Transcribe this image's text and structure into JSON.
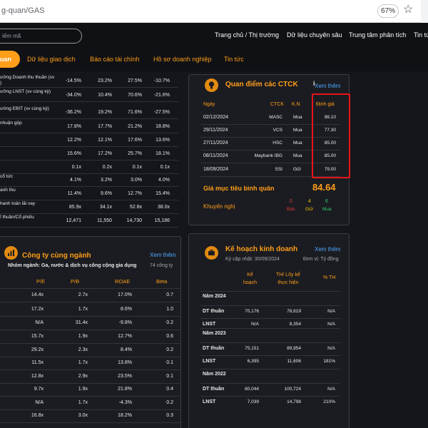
{
  "browser": {
    "url": "g-quan/GAS",
    "zoom": "67%"
  },
  "search": {
    "placeholder": "iếm mã"
  },
  "nav": [
    "Trang chủ / Thị trường",
    "Dữ liệu chuyên sâu",
    "Trung tâm phân tích",
    "Tin tứ"
  ],
  "tabs": {
    "active": "uan",
    "items": [
      "Dữ liệu giao dịch",
      "Báo cáo tài chính",
      "Hồ sơ doanh nghiệp",
      "Tin tức"
    ]
  },
  "financials": [
    {
      "label": "ưởng Doanh thu thuần (sv\n)",
      "values": [
        "-14.5%",
        "23.2%",
        "27.5%",
        "-10.7%"
      ]
    },
    {
      "label": "ưởng LNST (sv cùng kỳ)",
      "values": [
        "-34.0%",
        "10.4%",
        "70.6%",
        "-21.6%"
      ]
    },
    {
      "label": "ưởng EBIT (sv cùng kỳ)",
      "values": [
        "-36.2%",
        "19.2%",
        "71.6%",
        "-27.5%"
      ]
    },
    {
      "label": "nhuận gộp",
      "values": [
        "17.8%",
        "17.7%",
        "21.2%",
        "18.8%"
      ]
    },
    {
      "label": "",
      "values": [
        "12.2%",
        "12.1%",
        "17.6%",
        "13.6%"
      ]
    },
    {
      "label": "",
      "values": [
        "15.6%",
        "17.2%",
        "25.7%",
        "18.1%"
      ]
    },
    {
      "label": "",
      "values": [
        "0.1x",
        "0.2x",
        "0.1x",
        "0.1x"
      ]
    },
    {
      "label": "cổ tức",
      "values": [
        "4.1%",
        "3.2%",
        "3.0%",
        "4.0%"
      ]
    },
    {
      "label": "anh thu",
      "values": [
        "11.4%",
        "9.6%",
        "12.7%",
        "15.4%"
      ]
    },
    {
      "label": "hanh toán lãi vay",
      "values": [
        "85.9x",
        "34.1x",
        "52.8x",
        "38.0x"
      ]
    },
    {
      "label": "ĩ thuần/Cổ phiếu",
      "values": [
        "12,471",
        "11,550",
        "14,730",
        "15,186"
      ]
    }
  ],
  "broker": {
    "title": "Quan điểm các CTCK",
    "info": "i",
    "see_more": "Xem thêm",
    "headers": {
      "date": "Ngày",
      "ctck": "CTCK",
      "kn": "K.N",
      "price": "Định giá"
    },
    "rows": [
      {
        "date": "02/12/2024",
        "ctck": "MASC",
        "kn": "Mua",
        "price": "96.10"
      },
      {
        "date": "29/11/2024",
        "ctck": "VCS",
        "kn": "Mua",
        "price": "77.30"
      },
      {
        "date": "27/11/2024",
        "ctck": "HSC",
        "kn": "Mua",
        "price": "85.00"
      },
      {
        "date": "08/11/2024",
        "ctck": "Maybank IBG",
        "kn": "Mua",
        "price": "85.00"
      },
      {
        "date": "18/09/2024",
        "ctck": "SSI",
        "kn": "Giữ",
        "price": "79.00"
      }
    ],
    "avg_label": "Giá mục tiêu bình quân",
    "avg_value": "84.64",
    "rec_label": "Khuyến nghị",
    "rec": [
      {
        "count": "0",
        "label": "Bán",
        "color": "#e53935"
      },
      {
        "count": "4",
        "label": "Giữ",
        "color": "#f2c200"
      },
      {
        "count": "6",
        "label": "Mua",
        "color": "#2ecc71"
      }
    ]
  },
  "peers": {
    "title": "Công ty cùng ngành",
    "subtitle": "Nhóm ngành: Ga, nước & dịch vụ công cộng gia dụng",
    "see_more": "Xem thêm",
    "count": "74 công ty",
    "headers": [
      "P/E",
      "P/B",
      "ROAE",
      "Beta"
    ],
    "rows": [
      [
        "14.4x",
        "2.7x",
        "17.0%",
        "0.7"
      ],
      [
        "17.2x",
        "1.7x",
        "8.6%",
        "1.0"
      ],
      [
        "N/A",
        "31.4x",
        "-9.8%",
        "0.2"
      ],
      [
        "15.7x",
        "1.9x",
        "12.7%",
        "0.6"
      ],
      [
        "29.2x",
        "2.3x",
        "8.4%",
        "0.2"
      ],
      [
        "11.5x",
        "1.7x",
        "13.8%",
        "0.1"
      ],
      [
        "12.8x",
        "2.9x",
        "23.5%",
        "0.1"
      ],
      [
        "9.7x",
        "1.9x",
        "21.8%",
        "0.4"
      ],
      [
        "N/A",
        "1.7x",
        "-4.3%",
        "0.2"
      ],
      [
        "16.8x",
        "3.0x",
        "18.2%",
        "0.3"
      ]
    ]
  },
  "plan": {
    "title": "Kế hoạch kinh doanh",
    "see_more": "Xem thêm",
    "updated": "Kỳ cập nhật: 30/09/2024",
    "unit": "Đơn vị: Tỷ đồng",
    "headers": {
      "plan": "Kế\nhoạch",
      "actual": "TH/ Lũy kế\nthực hiện",
      "pct": "% TH"
    },
    "years": [
      {
        "year": "Năm 2024",
        "rows": [
          [
            "DT thuần",
            "70,176",
            "78,619",
            "N/A"
          ],
          [
            "LNST",
            "N/A",
            "8,354",
            "N/A"
          ]
        ]
      },
      {
        "year": "Năm 2023",
        "rows": [
          [
            "DT thuần",
            "75,151",
            "89,954",
            "N/A"
          ],
          [
            "LNST",
            "6,395",
            "11,606",
            "181%"
          ]
        ]
      },
      {
        "year": "Năm 2022",
        "rows": [
          [
            "DT thuần",
            "80,044",
            "100,724",
            "N/A"
          ],
          [
            "LNST",
            "7,039",
            "14,798",
            "210%"
          ]
        ]
      }
    ]
  }
}
